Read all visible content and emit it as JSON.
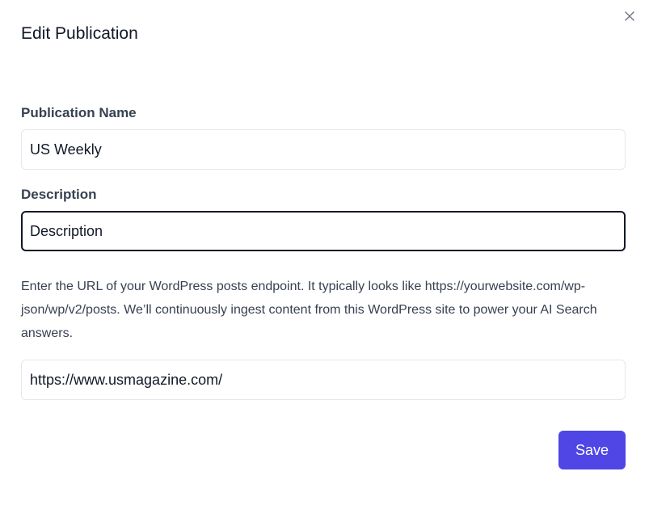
{
  "modal": {
    "title": "Edit Publication",
    "close_icon": "close-icon"
  },
  "form": {
    "name_label": "Publication Name",
    "name_value": "US Weekly",
    "description_label": "Description",
    "description_value": "Description",
    "help_text": "Enter the URL of your WordPress posts endpoint. It typically looks like https://yourwebsite.com/wp-json/wp/v2/posts. We’ll continuously ingest content from this WordPress site to power your AI Search answers.",
    "url_value": "https://www.usmagazine.com/"
  },
  "actions": {
    "save_label": "Save"
  },
  "colors": {
    "accent": "#4f46e5",
    "focus_border": "#111827"
  }
}
